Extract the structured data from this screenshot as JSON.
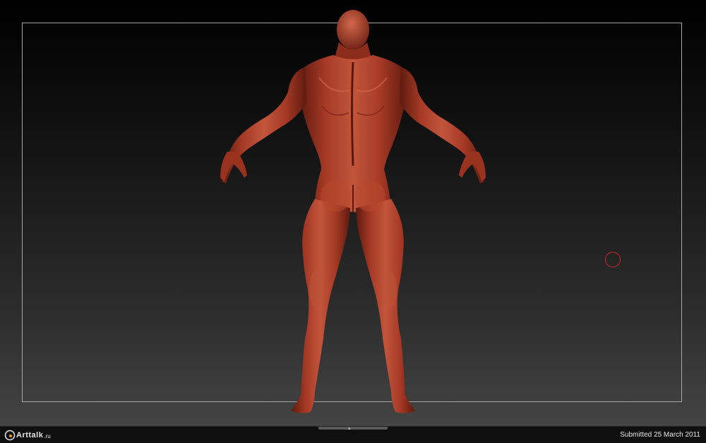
{
  "viewport": {
    "description_icon": "sculpt-model"
  },
  "cursor": {
    "icon": "brush-circle-icon",
    "color": "#d0281c"
  },
  "colors": {
    "skin": "#a63a26",
    "skin_highlight": "#d2674c",
    "skin_shadow": "#5e1a0f",
    "frame": "#a9a9a9"
  },
  "footer": {
    "logo_text": "Arttalk",
    "logo_tld": ".ru",
    "center_mark": "▴",
    "submitted": "Submitted 25 March 2011"
  }
}
